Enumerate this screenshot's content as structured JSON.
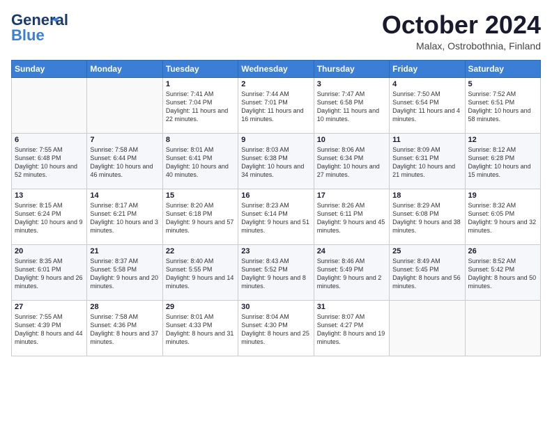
{
  "header": {
    "logo_line1": "General",
    "logo_line2": "Blue",
    "month": "October 2024",
    "location": "Malax, Ostrobothnia, Finland"
  },
  "weekdays": [
    "Sunday",
    "Monday",
    "Tuesday",
    "Wednesday",
    "Thursday",
    "Friday",
    "Saturday"
  ],
  "weeks": [
    [
      {
        "day": "",
        "sunrise": "",
        "sunset": "",
        "daylight": ""
      },
      {
        "day": "",
        "sunrise": "",
        "sunset": "",
        "daylight": ""
      },
      {
        "day": "1",
        "sunrise": "Sunrise: 7:41 AM",
        "sunset": "Sunset: 7:04 PM",
        "daylight": "Daylight: 11 hours and 22 minutes."
      },
      {
        "day": "2",
        "sunrise": "Sunrise: 7:44 AM",
        "sunset": "Sunset: 7:01 PM",
        "daylight": "Daylight: 11 hours and 16 minutes."
      },
      {
        "day": "3",
        "sunrise": "Sunrise: 7:47 AM",
        "sunset": "Sunset: 6:58 PM",
        "daylight": "Daylight: 11 hours and 10 minutes."
      },
      {
        "day": "4",
        "sunrise": "Sunrise: 7:50 AM",
        "sunset": "Sunset: 6:54 PM",
        "daylight": "Daylight: 11 hours and 4 minutes."
      },
      {
        "day": "5",
        "sunrise": "Sunrise: 7:52 AM",
        "sunset": "Sunset: 6:51 PM",
        "daylight": "Daylight: 10 hours and 58 minutes."
      }
    ],
    [
      {
        "day": "6",
        "sunrise": "Sunrise: 7:55 AM",
        "sunset": "Sunset: 6:48 PM",
        "daylight": "Daylight: 10 hours and 52 minutes."
      },
      {
        "day": "7",
        "sunrise": "Sunrise: 7:58 AM",
        "sunset": "Sunset: 6:44 PM",
        "daylight": "Daylight: 10 hours and 46 minutes."
      },
      {
        "day": "8",
        "sunrise": "Sunrise: 8:01 AM",
        "sunset": "Sunset: 6:41 PM",
        "daylight": "Daylight: 10 hours and 40 minutes."
      },
      {
        "day": "9",
        "sunrise": "Sunrise: 8:03 AM",
        "sunset": "Sunset: 6:38 PM",
        "daylight": "Daylight: 10 hours and 34 minutes."
      },
      {
        "day": "10",
        "sunrise": "Sunrise: 8:06 AM",
        "sunset": "Sunset: 6:34 PM",
        "daylight": "Daylight: 10 hours and 27 minutes."
      },
      {
        "day": "11",
        "sunrise": "Sunrise: 8:09 AM",
        "sunset": "Sunset: 6:31 PM",
        "daylight": "Daylight: 10 hours and 21 minutes."
      },
      {
        "day": "12",
        "sunrise": "Sunrise: 8:12 AM",
        "sunset": "Sunset: 6:28 PM",
        "daylight": "Daylight: 10 hours and 15 minutes."
      }
    ],
    [
      {
        "day": "13",
        "sunrise": "Sunrise: 8:15 AM",
        "sunset": "Sunset: 6:24 PM",
        "daylight": "Daylight: 10 hours and 9 minutes."
      },
      {
        "day": "14",
        "sunrise": "Sunrise: 8:17 AM",
        "sunset": "Sunset: 6:21 PM",
        "daylight": "Daylight: 10 hours and 3 minutes."
      },
      {
        "day": "15",
        "sunrise": "Sunrise: 8:20 AM",
        "sunset": "Sunset: 6:18 PM",
        "daylight": "Daylight: 9 hours and 57 minutes."
      },
      {
        "day": "16",
        "sunrise": "Sunrise: 8:23 AM",
        "sunset": "Sunset: 6:14 PM",
        "daylight": "Daylight: 9 hours and 51 minutes."
      },
      {
        "day": "17",
        "sunrise": "Sunrise: 8:26 AM",
        "sunset": "Sunset: 6:11 PM",
        "daylight": "Daylight: 9 hours and 45 minutes."
      },
      {
        "day": "18",
        "sunrise": "Sunrise: 8:29 AM",
        "sunset": "Sunset: 6:08 PM",
        "daylight": "Daylight: 9 hours and 38 minutes."
      },
      {
        "day": "19",
        "sunrise": "Sunrise: 8:32 AM",
        "sunset": "Sunset: 6:05 PM",
        "daylight": "Daylight: 9 hours and 32 minutes."
      }
    ],
    [
      {
        "day": "20",
        "sunrise": "Sunrise: 8:35 AM",
        "sunset": "Sunset: 6:01 PM",
        "daylight": "Daylight: 9 hours and 26 minutes."
      },
      {
        "day": "21",
        "sunrise": "Sunrise: 8:37 AM",
        "sunset": "Sunset: 5:58 PM",
        "daylight": "Daylight: 9 hours and 20 minutes."
      },
      {
        "day": "22",
        "sunrise": "Sunrise: 8:40 AM",
        "sunset": "Sunset: 5:55 PM",
        "daylight": "Daylight: 9 hours and 14 minutes."
      },
      {
        "day": "23",
        "sunrise": "Sunrise: 8:43 AM",
        "sunset": "Sunset: 5:52 PM",
        "daylight": "Daylight: 9 hours and 8 minutes."
      },
      {
        "day": "24",
        "sunrise": "Sunrise: 8:46 AM",
        "sunset": "Sunset: 5:49 PM",
        "daylight": "Daylight: 9 hours and 2 minutes."
      },
      {
        "day": "25",
        "sunrise": "Sunrise: 8:49 AM",
        "sunset": "Sunset: 5:45 PM",
        "daylight": "Daylight: 8 hours and 56 minutes."
      },
      {
        "day": "26",
        "sunrise": "Sunrise: 8:52 AM",
        "sunset": "Sunset: 5:42 PM",
        "daylight": "Daylight: 8 hours and 50 minutes."
      }
    ],
    [
      {
        "day": "27",
        "sunrise": "Sunrise: 7:55 AM",
        "sunset": "Sunset: 4:39 PM",
        "daylight": "Daylight: 8 hours and 44 minutes."
      },
      {
        "day": "28",
        "sunrise": "Sunrise: 7:58 AM",
        "sunset": "Sunset: 4:36 PM",
        "daylight": "Daylight: 8 hours and 37 minutes."
      },
      {
        "day": "29",
        "sunrise": "Sunrise: 8:01 AM",
        "sunset": "Sunset: 4:33 PM",
        "daylight": "Daylight: 8 hours and 31 minutes."
      },
      {
        "day": "30",
        "sunrise": "Sunrise: 8:04 AM",
        "sunset": "Sunset: 4:30 PM",
        "daylight": "Daylight: 8 hours and 25 minutes."
      },
      {
        "day": "31",
        "sunrise": "Sunrise: 8:07 AM",
        "sunset": "Sunset: 4:27 PM",
        "daylight": "Daylight: 8 hours and 19 minutes."
      },
      {
        "day": "",
        "sunrise": "",
        "sunset": "",
        "daylight": ""
      },
      {
        "day": "",
        "sunrise": "",
        "sunset": "",
        "daylight": ""
      }
    ]
  ]
}
